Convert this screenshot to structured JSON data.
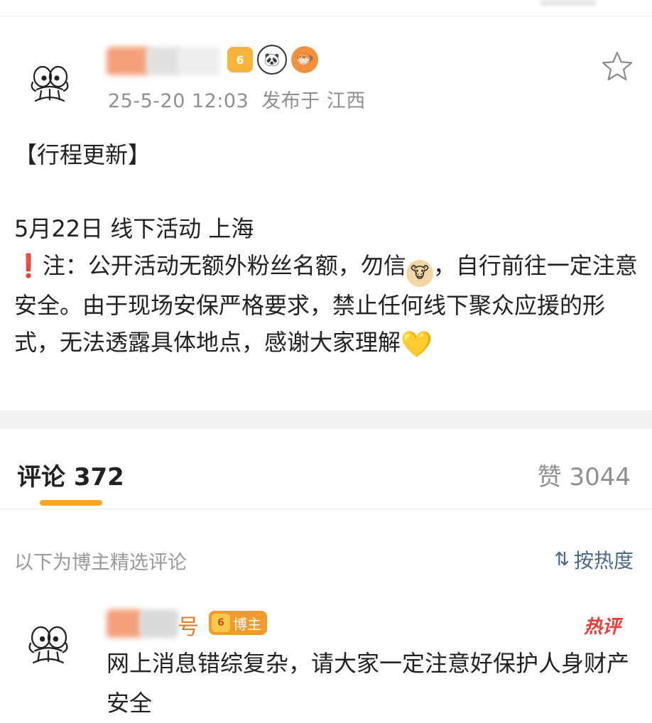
{
  "post": {
    "timestamp": "25-5-20 12:03",
    "location": "发布于 江西",
    "title": "【行程更新】",
    "line1": "5月22日 线下活动 上海",
    "notice_prefix": "❗️",
    "notice_part1": "注：公开活动无额外粉丝名额，勿信",
    "notice_part2": "，自行前往一定注意安全。由于现场安保严格要求，禁止任何线下聚众应援的形式，无法透露具体地点，感谢大家理解",
    "badge_level": "6",
    "heart": "💛",
    "cow": "🐮"
  },
  "tabs": {
    "comments_label": "评论 372",
    "likes_label": "赞 3044"
  },
  "comments_section": {
    "selected_label": "以下为博主精选评论",
    "sort_label": "按热度",
    "sort_icon": "⇅"
  },
  "comment": {
    "name_suffix": "号",
    "blogger_badge": "博主",
    "badge_level": "6",
    "hot_tag": "热评",
    "text": "网上消息错综复杂，请大家一定注意好保护人身财产安全"
  },
  "colors": {
    "accent": "#f5a623",
    "link": "#4a6785",
    "hot": "#e83b3b",
    "gray_text": "#8f8f8f"
  }
}
